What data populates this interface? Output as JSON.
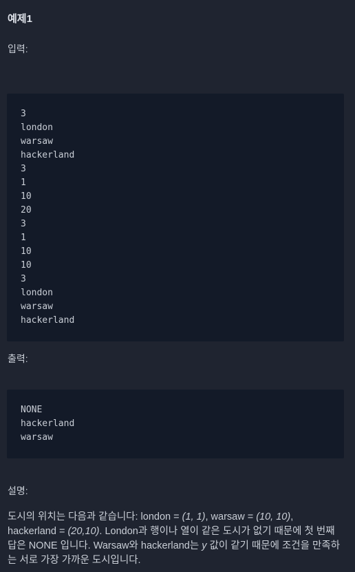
{
  "example": {
    "title": "예제1",
    "input_label": "입력:",
    "input_lines": [
      "3",
      "london",
      "warsaw",
      "hackerland",
      "3",
      "1",
      "10",
      "20",
      "3",
      "1",
      "10",
      "10",
      "3",
      "london",
      "warsaw",
      "hackerland"
    ],
    "output_label": "출력:",
    "output_lines": [
      "NONE",
      "hackerland",
      "warsaw"
    ],
    "explanation_label": "설명:",
    "explanation": {
      "p1": "도시의 위치는 다음과 같습니다: london = ",
      "v1": "(1, 1)",
      "p2": ", warsaw = ",
      "v2": "(10, 10)",
      "p3": ", hackerland = ",
      "v3": "(20,10)",
      "p4": ". London과 행이나 열이 같은 도시가 없기 때문에 첫 번째 답은 NONE 입니다. Warsaw와 hackerland는 ",
      "v4": "y",
      "p5": " 값이 같기 때문에 조건을 만족하는 서로 가장 가까운 도시입니다."
    }
  }
}
